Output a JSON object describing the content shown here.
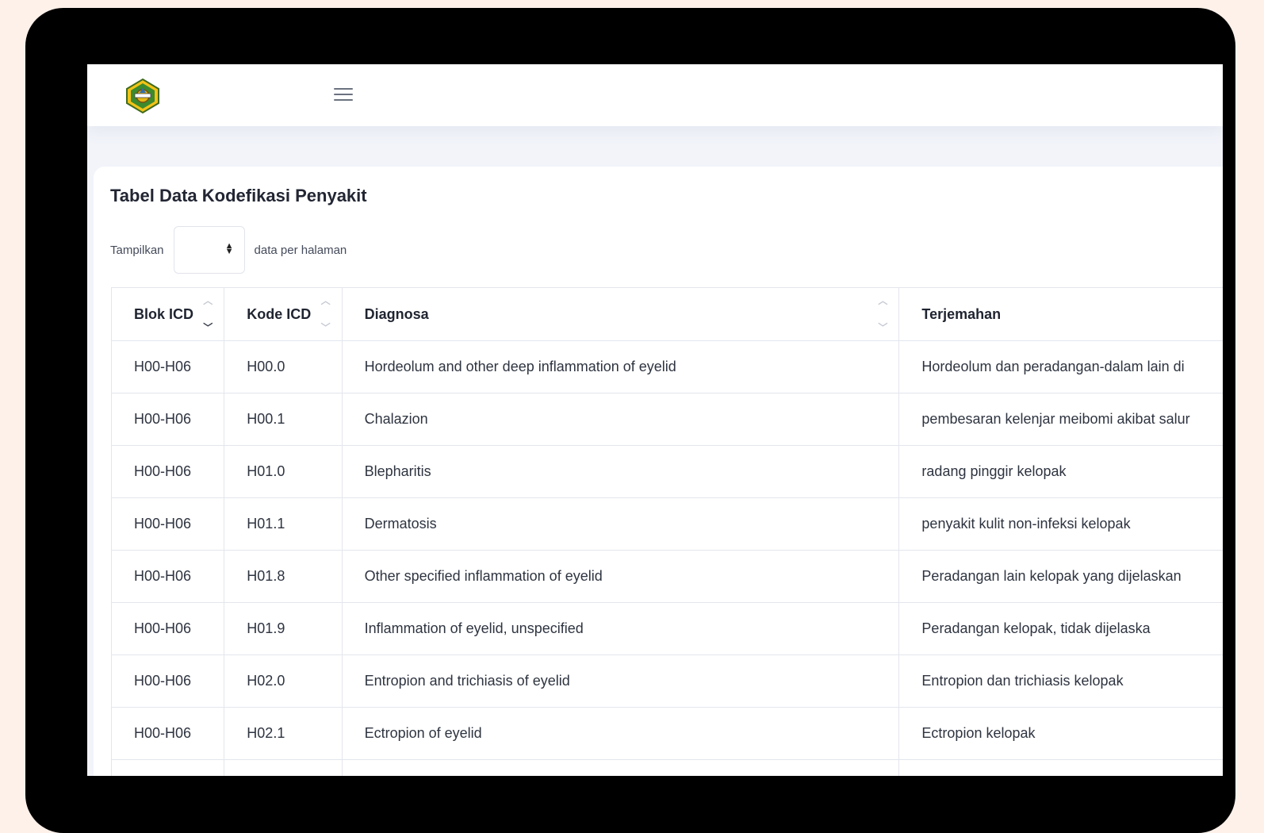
{
  "header": {
    "logo_icon": "government-emblem-logo",
    "menu_icon": "hamburger-menu-icon"
  },
  "card": {
    "title": "Tabel Data Kodefikasi Penyakit",
    "length_prefix": "Tampilkan",
    "length_value": "",
    "length_suffix": "data per halaman"
  },
  "table": {
    "headers": [
      "Blok ICD",
      "Kode ICD",
      "Diagnosa",
      "Terjemahan"
    ],
    "rows": [
      [
        "H00-H06",
        "H00.0",
        "Hordeolum and other deep inflammation of eyelid",
        "Hordeolum dan peradangan-dalam lain di"
      ],
      [
        "H00-H06",
        "H00.1",
        "Chalazion",
        "pembesaran kelenjar meibomi akibat salur"
      ],
      [
        "H00-H06",
        "H01.0",
        "Blepharitis",
        "radang pinggir kelopak"
      ],
      [
        "H00-H06",
        "H01.1",
        "Dermatosis",
        "penyakit kulit non-infeksi kelopak"
      ],
      [
        "H00-H06",
        "H01.8",
        "Other specified inflammation of eyelid",
        "Peradangan lain kelopak yang dijelaskan"
      ],
      [
        "H00-H06",
        "H01.9",
        "Inflammation of eyelid, unspecified",
        "Peradangan kelopak, tidak dijelaska"
      ],
      [
        "H00-H06",
        "H02.0",
        "Entropion and trichiasis of eyelid",
        "Entropion dan trichiasis kelopak"
      ],
      [
        "H00-H06",
        "H02.1",
        "Ectropion of eyelid",
        "Ectropion kelopak"
      ],
      [
        "",
        "",
        "",
        ""
      ]
    ]
  },
  "colors": {
    "device_frame": "#000000",
    "page_background": "#fdf1ea",
    "content_background": "#f2f4fa",
    "card_background": "#ffffff",
    "border": "#e3e6ec"
  }
}
